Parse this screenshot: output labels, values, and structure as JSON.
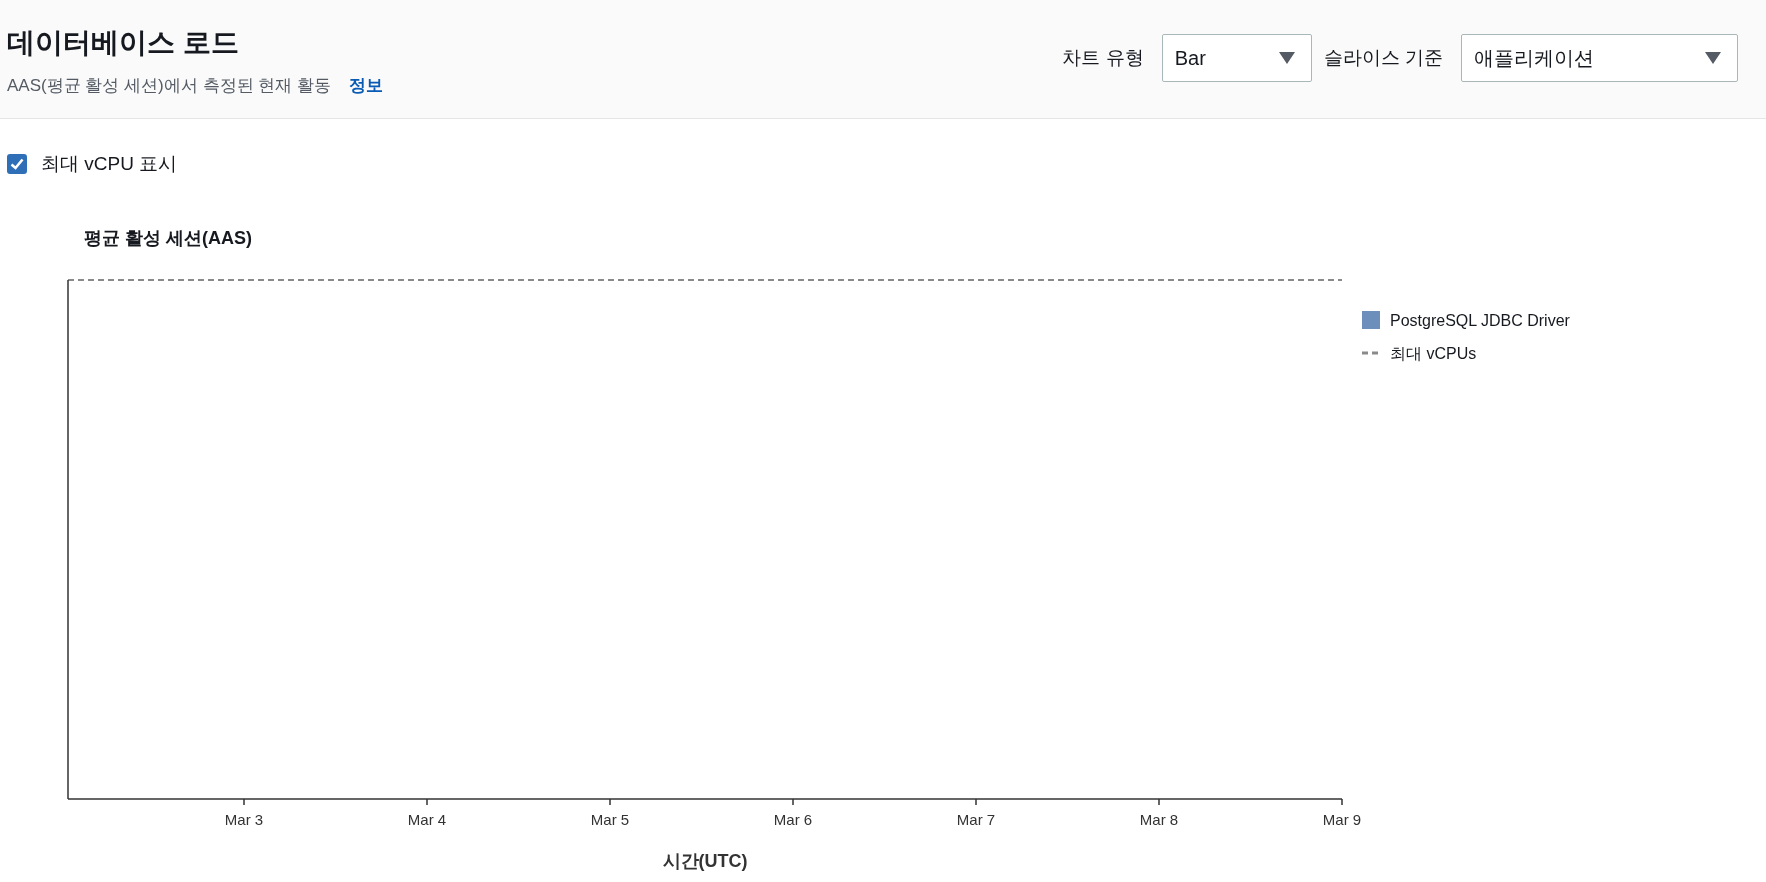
{
  "header": {
    "title": "데이터베이스 로드",
    "subtitle": "AAS(평균 활성 세션)에서 측정된 현재 활동",
    "info_link": "정보",
    "controls": [
      {
        "label": "차트 유형",
        "value": "Bar",
        "kind": "narrow"
      },
      {
        "label": "슬라이스 기준",
        "value": "애플리케이션",
        "kind": "wide"
      }
    ]
  },
  "show_max_vcpu": {
    "label": "최대 vCPU 표시",
    "checked": true
  },
  "chart_data": {
    "type": "other",
    "title": "평균 활성 세션(AAS)",
    "xlabel": "시간(UTC)",
    "categories": [
      "Mar 3",
      "Mar 4",
      "Mar 5",
      "Mar 6",
      "Mar 7",
      "Mar 8",
      "Mar 9"
    ],
    "series": [
      {
        "name": "PostgreSQL JDBC Driver",
        "color": "#6d8fbb",
        "values": [
          null,
          null,
          null,
          null,
          null,
          null,
          null
        ]
      }
    ],
    "ref_lines": [
      {
        "label": "최대 vCPUs",
        "color": "#8a8a8a"
      }
    ]
  }
}
